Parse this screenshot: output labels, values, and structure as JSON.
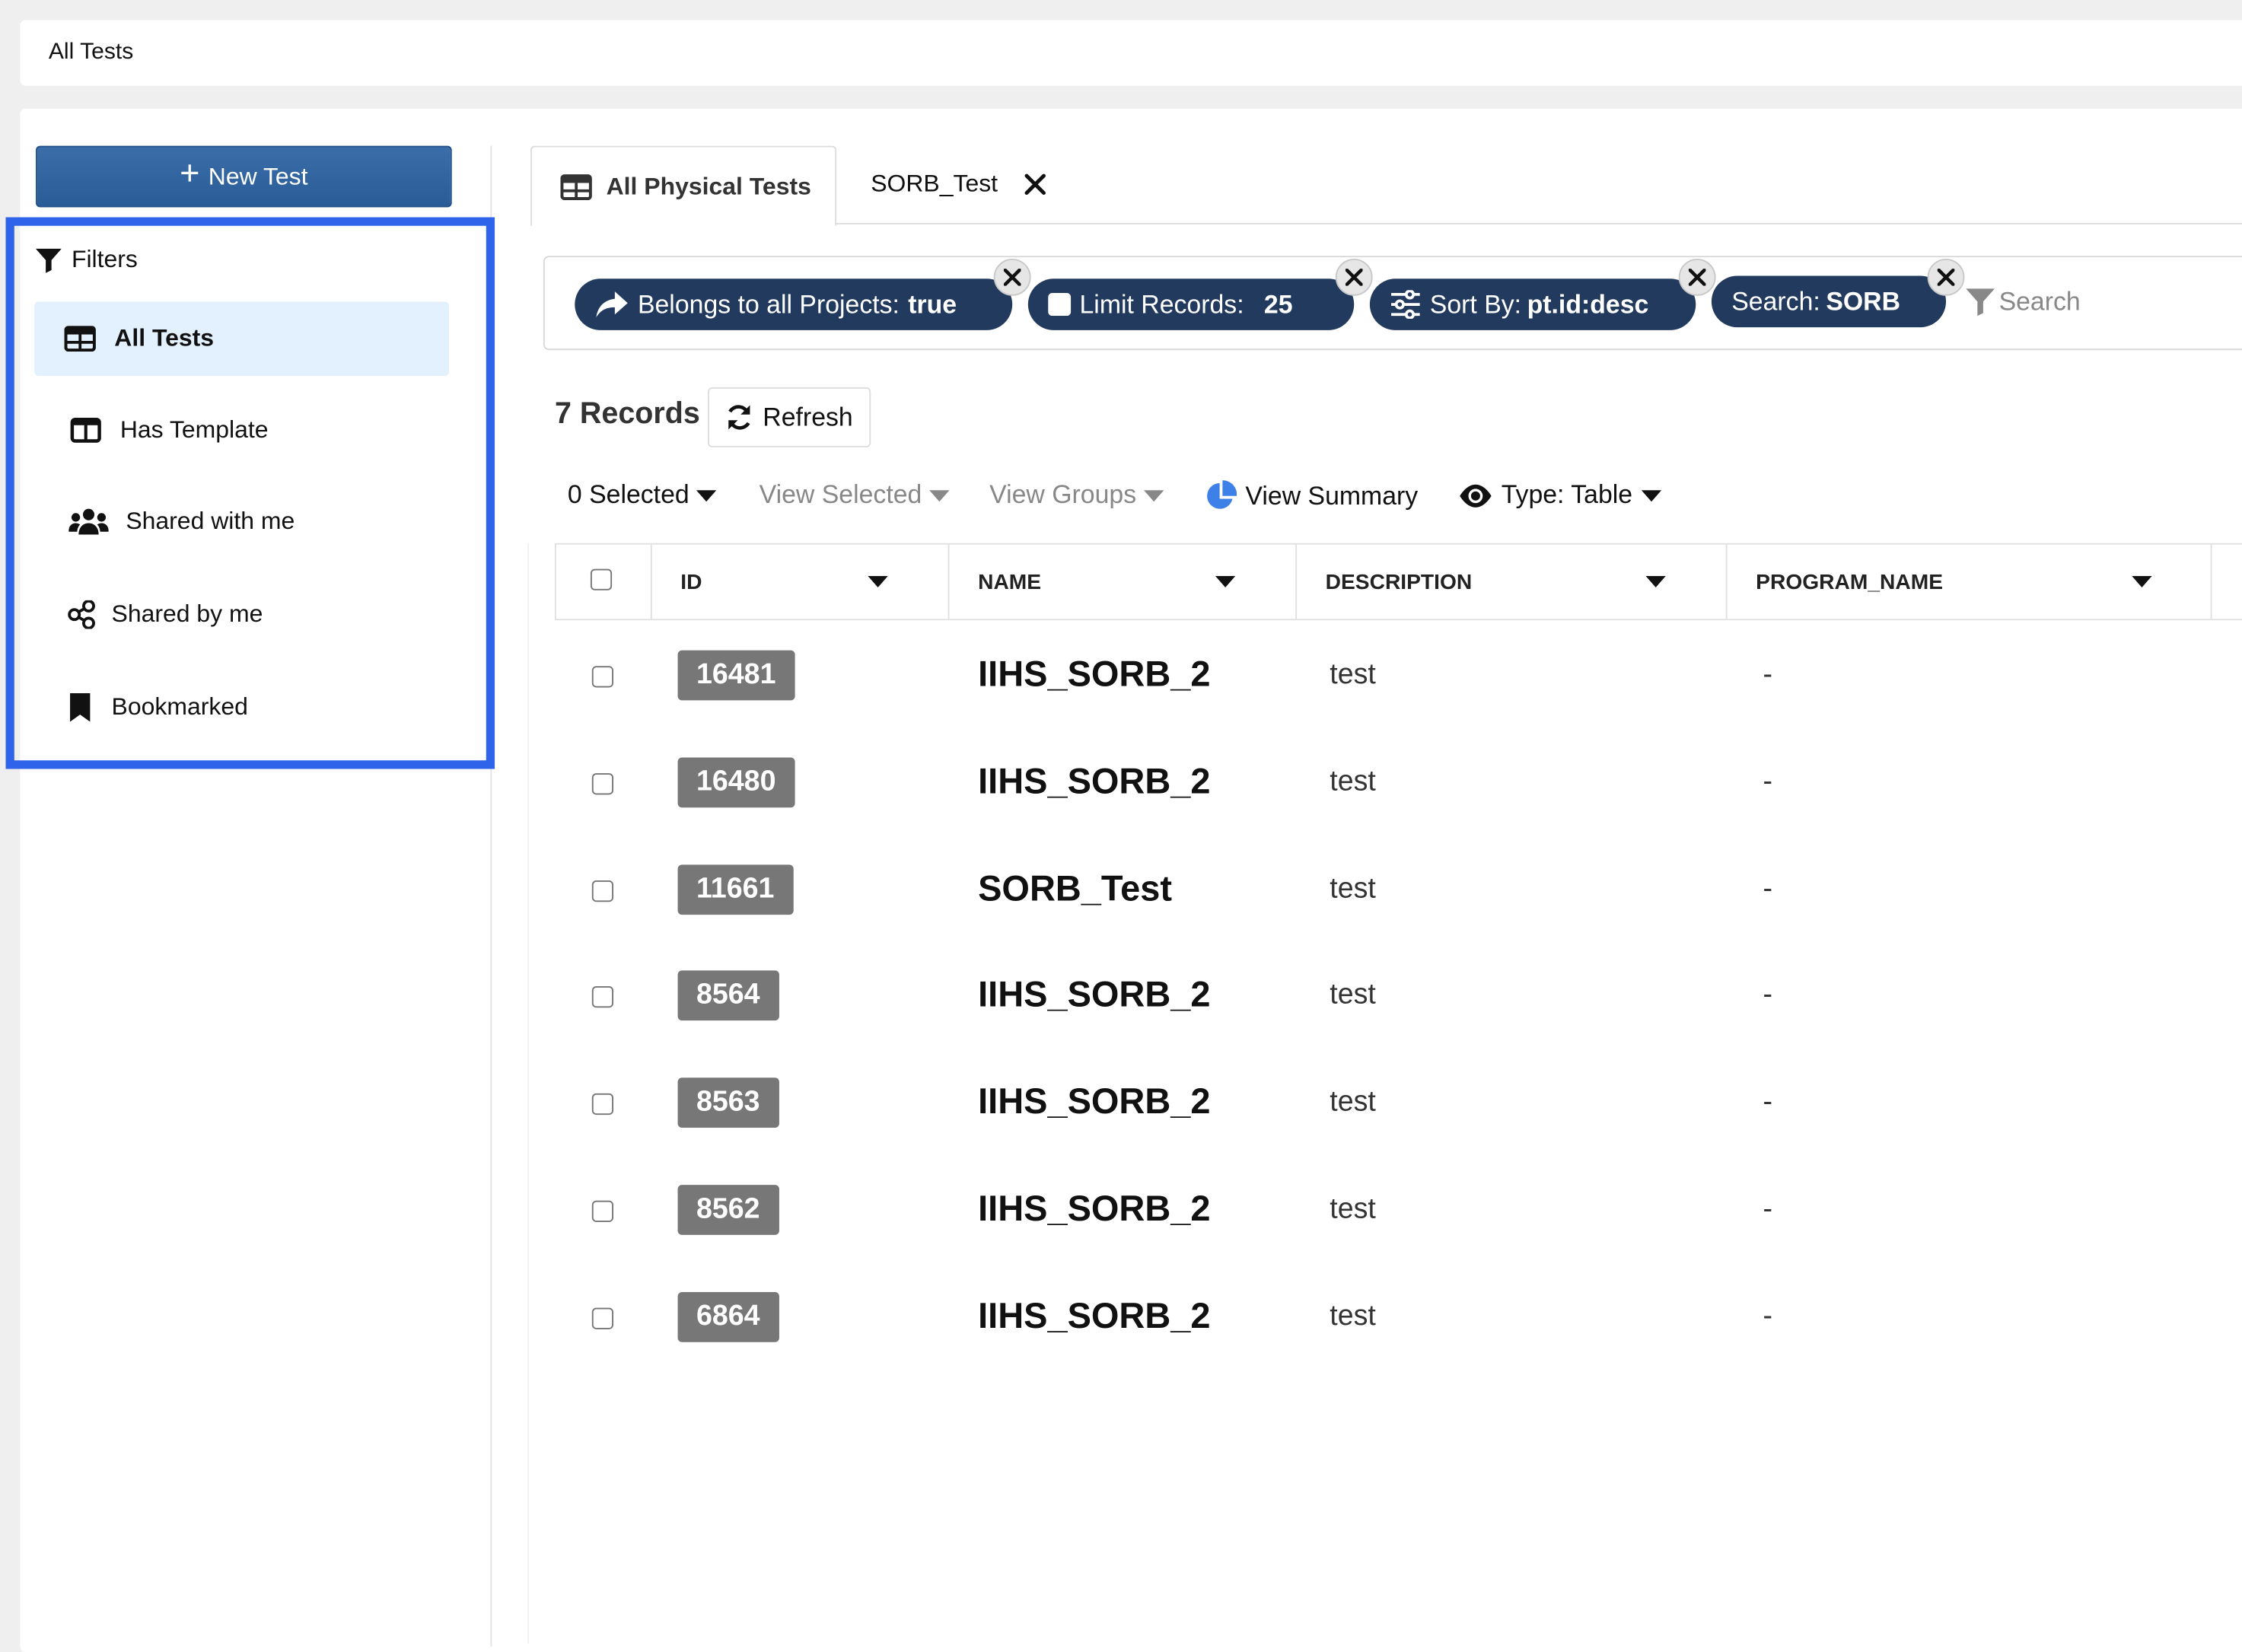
{
  "breadcrumb": "All Tests",
  "sidebar": {
    "new_button": "New Test",
    "filters_label": "Filters",
    "items": [
      {
        "label": "All Tests",
        "icon": "table-icon",
        "active": true
      },
      {
        "label": "Has Template",
        "icon": "columns-icon",
        "active": false
      },
      {
        "label": "Shared with me",
        "icon": "users-icon",
        "active": false
      },
      {
        "label": "Shared by me",
        "icon": "share-icon",
        "active": false
      },
      {
        "label": "Bookmarked",
        "icon": "bookmark-icon",
        "active": false
      }
    ]
  },
  "tabs": [
    {
      "label": "All Physical Tests",
      "icon": "table-icon",
      "active": true
    },
    {
      "label": "SORB_Test",
      "closable": true,
      "active": false
    }
  ],
  "chips": [
    {
      "label": "Belongs to all Projects:",
      "value": "true",
      "icon": "share-arrow-icon"
    },
    {
      "label": "Limit Records:",
      "value": "25",
      "icon": "square-icon"
    },
    {
      "label": "Sort By:",
      "value": "pt.id:desc",
      "icon": "sliders-icon"
    },
    {
      "label": "Search:",
      "value": "SORB"
    }
  ],
  "search": {
    "placeholder": "Search",
    "value": ""
  },
  "records_label": "7 Records",
  "refresh_label": "Refresh",
  "toolbar": {
    "selected": "0 Selected",
    "view_selected": "View Selected",
    "view_groups": "View Groups",
    "view_summary": "View Summary",
    "type": "Type: Table"
  },
  "table": {
    "columns": [
      "ID",
      "NAME",
      "DESCRIPTION",
      "PROGRAM_NAME"
    ],
    "rows": [
      {
        "id": "16481",
        "name": "IIHS_SORB_2",
        "description": "test",
        "program": "-"
      },
      {
        "id": "16480",
        "name": "IIHS_SORB_2",
        "description": "test",
        "program": "-"
      },
      {
        "id": "11661",
        "name": "SORB_Test",
        "description": "test",
        "program": "-"
      },
      {
        "id": "8564",
        "name": "IIHS_SORB_2",
        "description": "test",
        "program": "-"
      },
      {
        "id": "8563",
        "name": "IIHS_SORB_2",
        "description": "test",
        "program": "-"
      },
      {
        "id": "8562",
        "name": "IIHS_SORB_2",
        "description": "test",
        "program": "-"
      },
      {
        "id": "6864",
        "name": "IIHS_SORB_2",
        "description": "test",
        "program": "-"
      }
    ]
  },
  "colors": {
    "primary": "#2a5c97",
    "chip": "#223a5e",
    "highlight_border": "#2f63ea",
    "active_item": "#e3f0fe",
    "badge": "#777777"
  }
}
